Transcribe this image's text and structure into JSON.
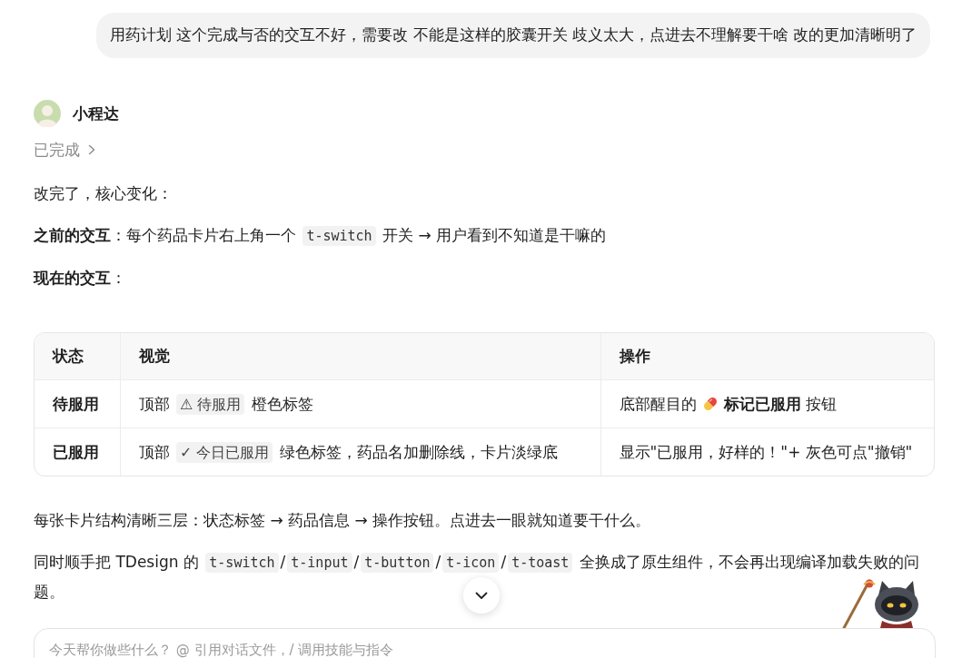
{
  "user_message": {
    "text": "用药计划 这个完成与否的交互不好，需要改 不能是这样的胶囊开关 歧义太大，点进去不理解要干啥 改的更加清晰明了"
  },
  "assistant": {
    "name": "小程达",
    "status": {
      "label": "已完成",
      "expanded": false
    }
  },
  "paragraphs_before": [
    [
      {
        "kind": "text",
        "text": "改完了，核心变化："
      }
    ],
    [
      {
        "kind": "text",
        "text": "**之前的交互**：每个药品卡片右上角一个 "
      },
      {
        "kind": "code",
        "text": "t-switch"
      },
      {
        "kind": "text",
        "text": " 开关 → 用户看到不知道是干嘛的"
      }
    ],
    [
      {
        "kind": "text",
        "text": "**现在的交互**："
      }
    ]
  ],
  "table": {
    "columns": [
      "状态",
      "视觉",
      "操作"
    ],
    "rows": [
      [
        [
          {
            "kind": "text",
            "text": "待服用"
          }
        ],
        [
          {
            "kind": "text",
            "text": "顶部 "
          },
          {
            "kind": "code",
            "text": "⚠ 待服用"
          },
          {
            "kind": "text",
            "text": " 橙色标签"
          }
        ],
        [
          {
            "kind": "text",
            "text": "底部醒目的"
          },
          {
            "kind": "icon"
          },
          {
            "kind": "text",
            "text": "**标记已服用** 按钮"
          }
        ]
      ],
      [
        [
          {
            "kind": "text",
            "text": "已服用"
          }
        ],
        [
          {
            "kind": "text",
            "text": "顶部 "
          },
          {
            "kind": "code",
            "text": "✓ 今日已服用"
          },
          {
            "kind": "text",
            "text": " 绿色标签，药品名加删除线，卡片淡绿底"
          }
        ],
        [
          {
            "kind": "text",
            "text": "显示\"已服用，好样的！\"+ 灰色可点\"撤销\""
          }
        ]
      ]
    ]
  },
  "paragraphs_after": [
    [
      {
        "kind": "text",
        "text": "每张卡片结构清晰三层：状态标签 → 药品信息 → 操作按钮。点进去一眼就知道要干什么。"
      }
    ],
    [
      {
        "kind": "text",
        "text": "同时顺手把 TDesign 的 "
      },
      {
        "kind": "code",
        "text": "t-switch"
      },
      {
        "kind": "text",
        "text": "/"
      },
      {
        "kind": "code",
        "text": "t-input"
      },
      {
        "kind": "text",
        "text": "/"
      },
      {
        "kind": "code",
        "text": "t-button"
      },
      {
        "kind": "text",
        "text": "/"
      },
      {
        "kind": "code",
        "text": "t-icon"
      },
      {
        "kind": "text",
        "text": "/"
      },
      {
        "kind": "code",
        "text": "t-toast"
      },
      {
        "kind": "text",
        "text": " 全换成了原生组件，不会再出现编译加载失败的问题。"
      }
    ]
  ],
  "composer": {
    "placeholder": "今天帮你做些什么？ @ 引用对话文件，/ 调用技能与指令"
  }
}
